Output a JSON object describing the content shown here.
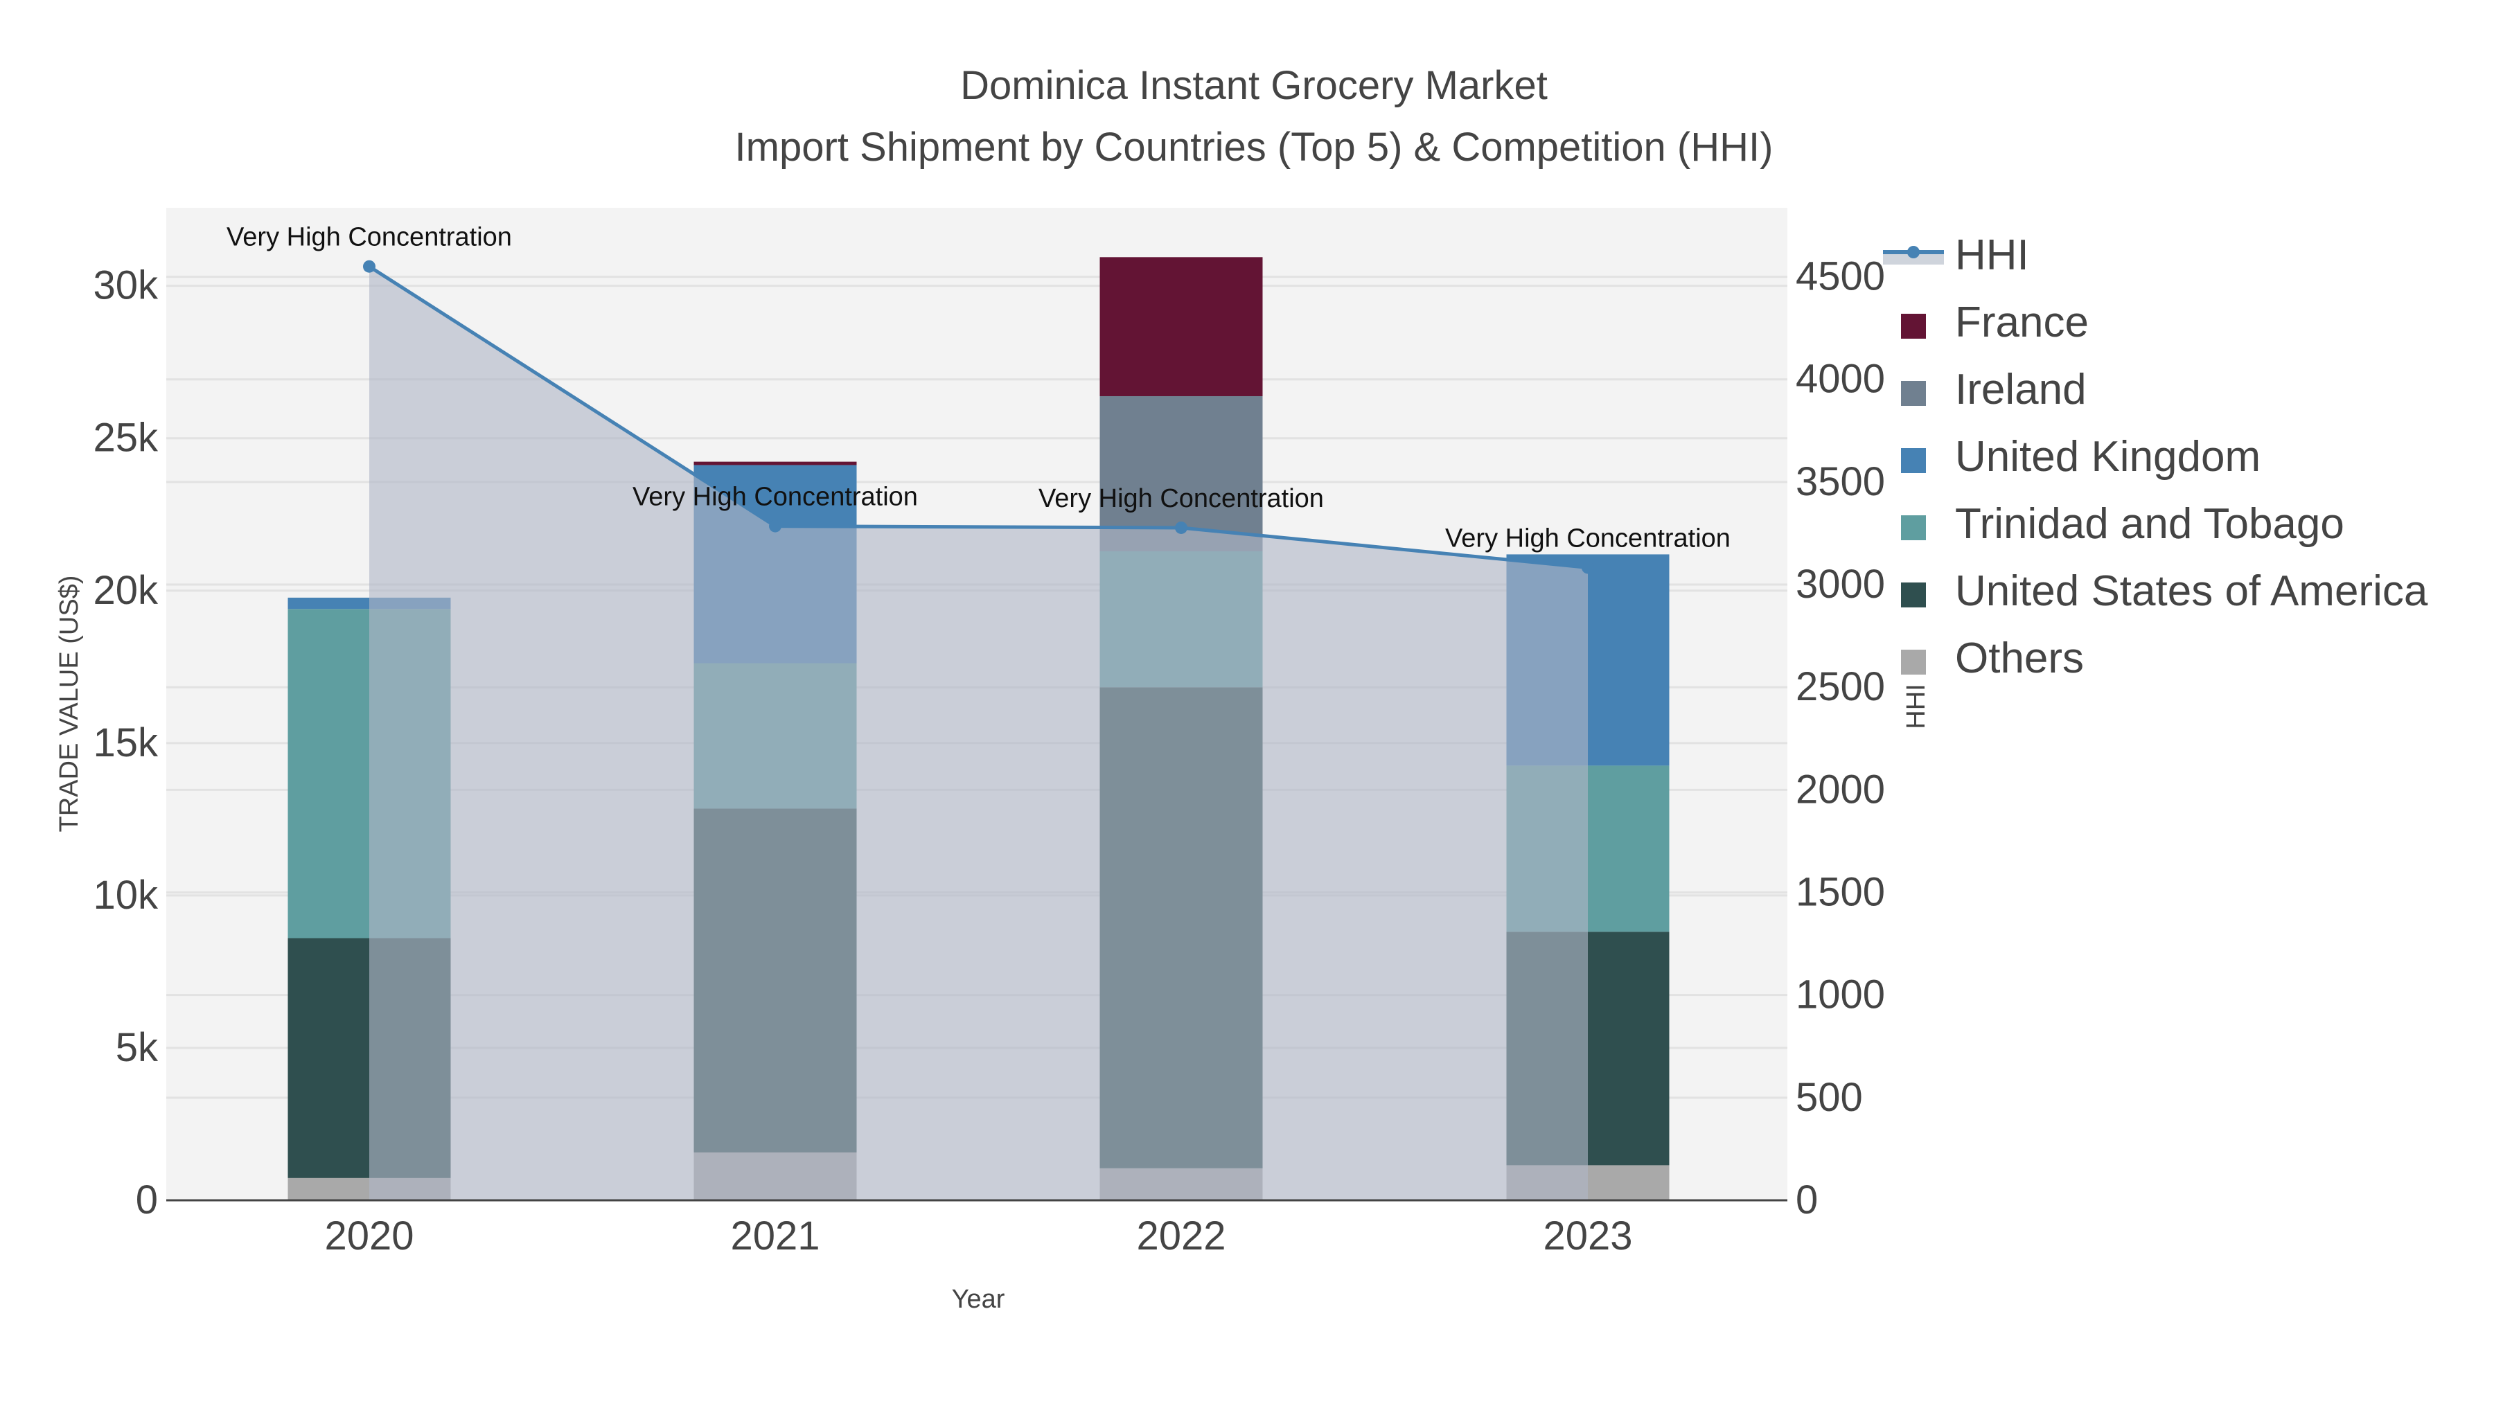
{
  "chart_data": {
    "type": "bar",
    "title": "Dominica Instant Grocery Market",
    "subtitle": "Import Shipment by Countries (Top 5) & Competition (HHI)",
    "xlabel": "Year",
    "ylabel": "TRADE VALUE (US$)",
    "y2label": "HHI",
    "categories": [
      "2020",
      "2021",
      "2022",
      "2023"
    ],
    "ylim": [
      0,
      32560
    ],
    "y2lim": [
      0,
      4836
    ],
    "yticks": [
      0,
      5000,
      10000,
      15000,
      20000,
      25000,
      30000
    ],
    "ytick_labels": [
      "0",
      "5k",
      "10k",
      "15k",
      "20k",
      "25k",
      "30k"
    ],
    "y2ticks": [
      0,
      500,
      1000,
      1500,
      2000,
      2500,
      3000,
      3500,
      4000,
      4500
    ],
    "y2tick_labels": [
      "0",
      "500",
      "1000",
      "1500",
      "2000",
      "2500",
      "3000",
      "3500",
      "4000",
      "4500"
    ],
    "barmode": "stack",
    "series": [
      {
        "name": "Others",
        "color": "#a9a9a9",
        "values": [
          730,
          1570,
          1050,
          1150
        ]
      },
      {
        "name": "United States of America",
        "color": "#2f4f4f",
        "values": [
          7870,
          11280,
          15780,
          7660
        ]
      },
      {
        "name": "Trinidad and Tobago",
        "color": "#5f9ea0",
        "values": [
          10800,
          4770,
          4460,
          5450
        ]
      },
      {
        "name": "United Kingdom",
        "color": "#4682b4",
        "values": [
          370,
          6500,
          0,
          6930
        ]
      },
      {
        "name": "Ireland",
        "color": "#708090",
        "values": [
          0,
          0,
          5090,
          0
        ]
      },
      {
        "name": "France",
        "color": "#631434",
        "values": [
          0,
          110,
          4560,
          0
        ]
      }
    ],
    "line": {
      "name": "HHI",
      "color": "#4682b4",
      "fill": "rgba(176,183,198,0.62)",
      "values": [
        4550,
        3285,
        3277,
        3083
      ]
    },
    "annotations": [
      "Very High Concentration",
      "Very High Concentration",
      "Very High Concentration",
      "Very High Concentration"
    ],
    "legend_order": [
      "HHI",
      "France",
      "Ireland",
      "United Kingdom",
      "Trinidad and Tobago",
      "United States of America",
      "Others"
    ],
    "legend_placement": "right",
    "grid": true
  }
}
